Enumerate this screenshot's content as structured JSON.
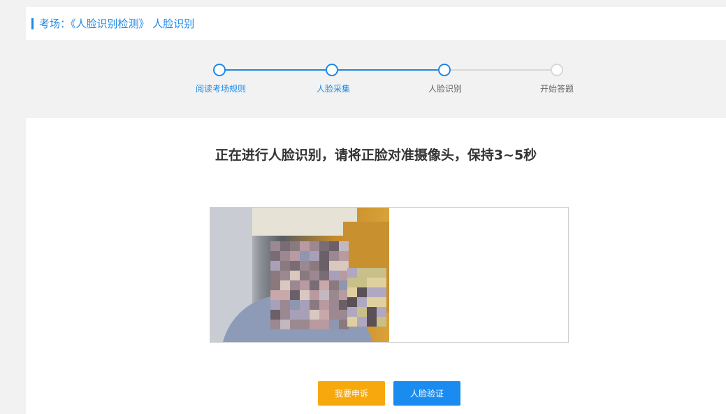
{
  "header": {
    "title": "考场：《人脸识别检测》 人脸识别"
  },
  "steps": [
    {
      "label": "阅读考场规则",
      "state": "done"
    },
    {
      "label": "人脸采集",
      "state": "done"
    },
    {
      "label": "人脸识别",
      "state": "current"
    },
    {
      "label": "开始答题",
      "state": "pending"
    }
  ],
  "main": {
    "instruction": "正在进行人脸识别，请将正脸对准摄像头，保持3~5秒"
  },
  "buttons": {
    "appeal": "我要申诉",
    "verify": "人脸验证"
  },
  "colors": {
    "accent": "#1e88e5",
    "appeal_bg": "#f7a80c",
    "verify_bg": "#1a8cef",
    "pending": "#d8d8d8",
    "label_active": "#1e88e5",
    "label_inactive": "#666666"
  }
}
